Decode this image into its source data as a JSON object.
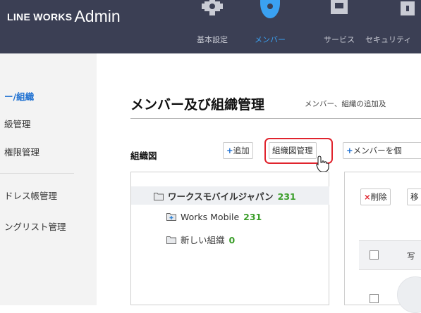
{
  "app": {
    "brand": "LINE WORKS",
    "section": "Admin"
  },
  "topnav": {
    "items": [
      {
        "label": "基本設定",
        "icon": "gear-icon",
        "active": false
      },
      {
        "label": "メンバー",
        "icon": "person-icon",
        "active": true
      },
      {
        "label": "サービス",
        "icon": "service-icon",
        "active": false
      },
      {
        "label": "セキュリティ",
        "icon": "lock-icon",
        "active": false
      }
    ]
  },
  "sidebar": {
    "items": [
      {
        "label": "ー/組織",
        "active": true
      },
      {
        "label": "級管理",
        "active": false
      },
      {
        "label": "権限管理",
        "active": false
      },
      {
        "label": "ドレス帳管理",
        "active": false
      },
      {
        "label": "ングリスト管理",
        "active": false
      }
    ]
  },
  "page": {
    "title": "メンバー及び組織管理",
    "subtitle": "メンバー、組織の追加及"
  },
  "org": {
    "label": "組織図",
    "add_button": "追加",
    "manage_button": "組織図管理",
    "add_member_button": "メンバーを個"
  },
  "tree": {
    "root": {
      "name": "ワークスモバイルジャパン",
      "count": "231"
    },
    "children": [
      {
        "name": "Works Mobile",
        "count": "231"
      },
      {
        "name": "新しい組織",
        "count": "0"
      }
    ]
  },
  "member_panel": {
    "delete_button": "削除",
    "move_button": "移",
    "col_photo": "写"
  },
  "colors": {
    "topbar": "#3b3f54",
    "active_nav": "#3aa1f2",
    "highlight": "#e0242e",
    "count_green": "#3b9e2a"
  }
}
